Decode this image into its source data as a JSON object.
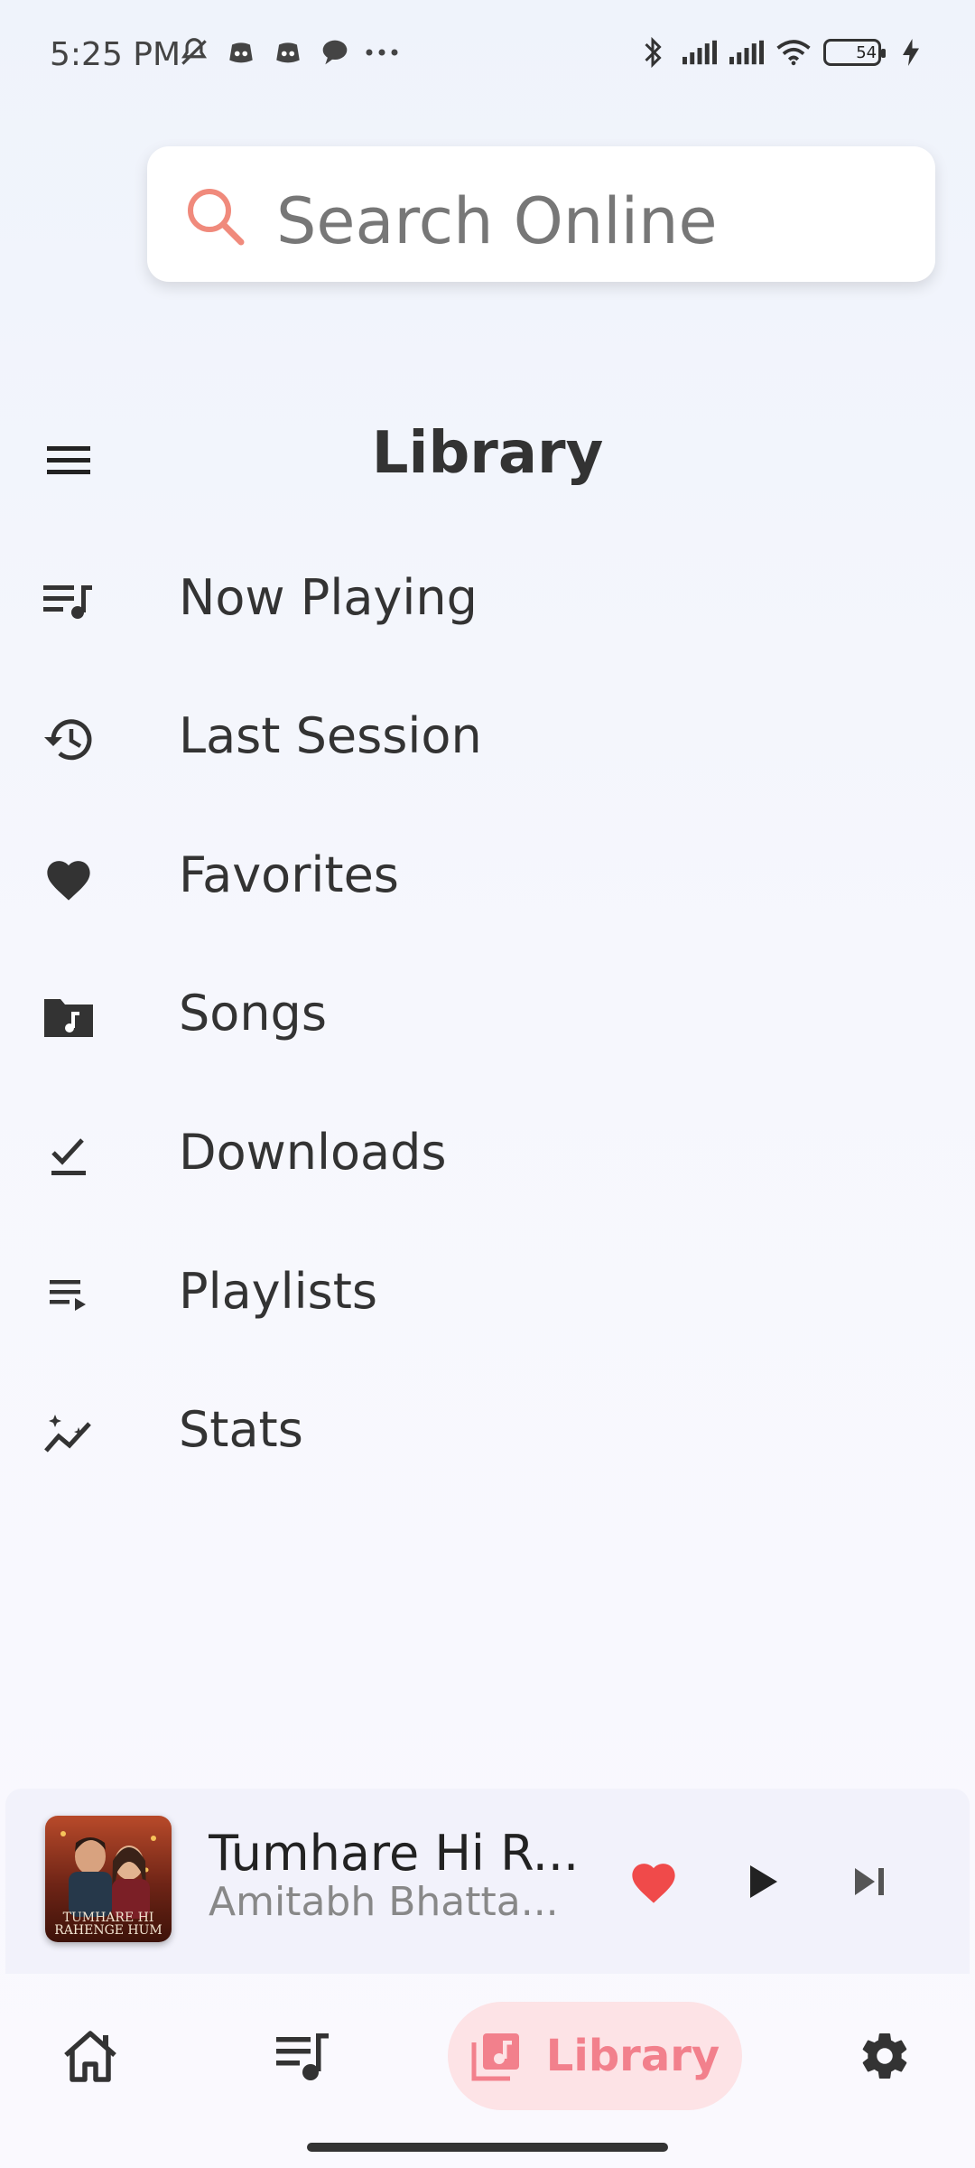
{
  "status_bar": {
    "time": "5:25 PM",
    "battery": "54",
    "icons": [
      "mute-alarm-icon",
      "discord-icon",
      "discord-icon",
      "chat-icon",
      "more-icon",
      "bluetooth-icon",
      "signal-icon",
      "signal-icon",
      "wifi-icon",
      "battery-icon",
      "charging-icon"
    ]
  },
  "search": {
    "placeholder": "Search Online",
    "icon": "search-icon",
    "accent": "#f08a7c"
  },
  "header": {
    "title": "Library",
    "menu_icon": "hamburger-icon"
  },
  "library": {
    "items": [
      {
        "label": "Now Playing",
        "icon": "queue-music-icon"
      },
      {
        "label": "Last Session",
        "icon": "history-icon"
      },
      {
        "label": "Favorites",
        "icon": "heart-icon"
      },
      {
        "label": "Songs",
        "icon": "music-folder-icon"
      },
      {
        "label": "Downloads",
        "icon": "download-done-icon"
      },
      {
        "label": "Playlists",
        "icon": "playlist-play-icon"
      },
      {
        "label": "Stats",
        "icon": "insights-icon"
      }
    ]
  },
  "mini_player": {
    "title": "Tumhare Hi R...",
    "artist": "Amitabh Bhatta...",
    "album_art_text": "TUMHARE HI RAHENGE HUM",
    "favorite_color": "#f04a4a"
  },
  "bottom_nav": {
    "items": [
      {
        "icon": "home-icon",
        "label": ""
      },
      {
        "icon": "queue-music-icon",
        "label": ""
      },
      {
        "icon": "library-music-icon",
        "label": "Library",
        "selected": true
      },
      {
        "icon": "settings-icon",
        "label": ""
      }
    ],
    "selected_color": "#f2808c"
  }
}
